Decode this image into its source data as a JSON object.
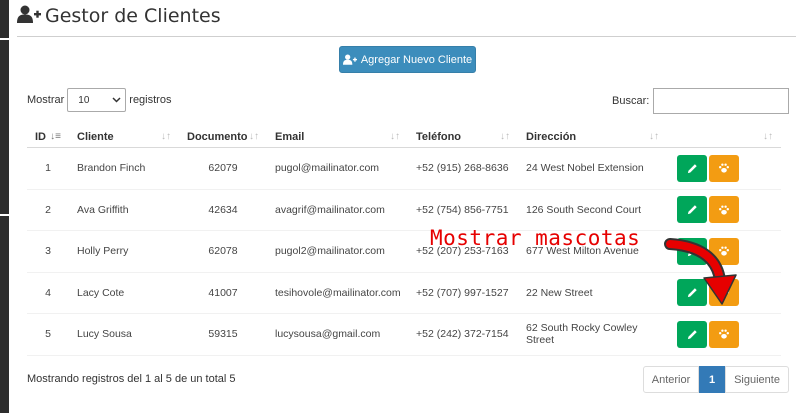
{
  "header": {
    "title": "Gestor de Clientes",
    "icon": "user-plus-icon"
  },
  "toolbar": {
    "add_label": "Agregar Nuevo Cliente"
  },
  "length": {
    "prefix": "Mostrar",
    "value": "10",
    "suffix": "registros"
  },
  "search": {
    "label": "Buscar:",
    "value": ""
  },
  "table": {
    "headers": [
      "ID",
      "Cliente",
      "Documento",
      "Email",
      "Teléfono",
      "Dirección",
      ""
    ],
    "rows": [
      [
        "1",
        "Brandon Finch",
        "62079",
        "pugol@mailinator.com",
        "+52 (915) 268-8636",
        "24 West Nobel Extension"
      ],
      [
        "2",
        "Ava Griffith",
        "42634",
        "avagrif@mailinator.com",
        "+52 (754) 856-7751",
        "126 South Second Court"
      ],
      [
        "3",
        "Holly Perry",
        "62078",
        "pugol2@mailinator.com",
        "+52 (207) 253-7163",
        "677 West Milton Avenue"
      ],
      [
        "4",
        "Lacy Cote",
        "41007",
        "tesihovole@mailinator.com",
        "+52 (707) 997-1527",
        "22 New Street"
      ],
      [
        "5",
        "Lucy Sousa",
        "59315",
        "lucysousa@gmail.com",
        "+52 (242) 372-7154",
        "62 South Rocky Cowley Street"
      ]
    ]
  },
  "footer": {
    "info": "Mostrando registros del 1 al 5 de un total 5"
  },
  "pagination": {
    "prev": "Anterior",
    "current": "1",
    "next": "Siguiente"
  },
  "annotation": {
    "text": "Mostrar mascotas",
    "color": "#e60000"
  },
  "colors": {
    "primary": "#3c8dbc",
    "edit": "#00a65a",
    "pets": "#f39c12",
    "page_active": "#337ab7"
  }
}
